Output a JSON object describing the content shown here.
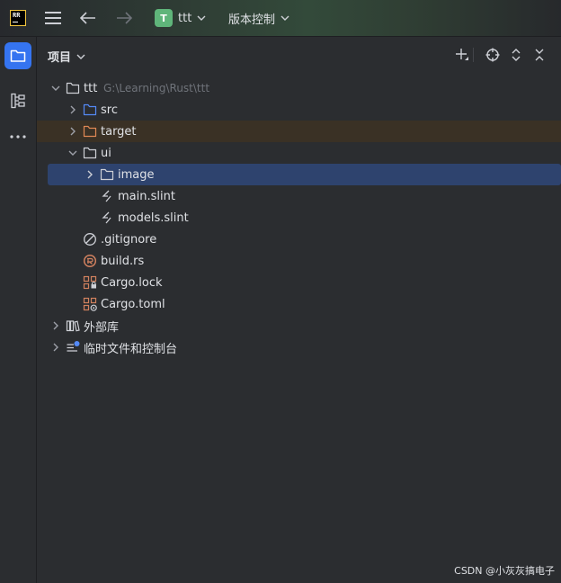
{
  "titlebar": {
    "logo_text": "RR",
    "project_badge": "T",
    "project_name": "ttt",
    "vcs_label": "版本控制"
  },
  "toolstrip": {
    "items": [
      {
        "name": "project",
        "icon": "folder-icon",
        "active": true
      },
      {
        "name": "structure",
        "icon": "structure-icon",
        "active": false
      },
      {
        "name": "more",
        "icon": "more-icon",
        "active": false
      }
    ]
  },
  "panel": {
    "title": "项目"
  },
  "tree": {
    "root": {
      "label": "ttt",
      "path": "G:\\Learning\\Rust\\ttt"
    },
    "items": [
      {
        "label": "src",
        "icon": "folder-icon"
      },
      {
        "label": "target",
        "icon": "folder-excluded-icon"
      },
      {
        "label": "ui",
        "icon": "folder-icon"
      },
      {
        "label": "image",
        "icon": "folder-icon"
      },
      {
        "label": "main.slint",
        "icon": "slint-file-icon"
      },
      {
        "label": "models.slint",
        "icon": "slint-file-icon"
      },
      {
        "label": ".gitignore",
        "icon": "ignore-file-icon"
      },
      {
        "label": "build.rs",
        "icon": "rust-file-icon"
      },
      {
        "label": "Cargo.lock",
        "icon": "cargo-lock-icon"
      },
      {
        "label": "Cargo.toml",
        "icon": "cargo-toml-icon"
      },
      {
        "label": "外部库",
        "icon": "library-icon"
      },
      {
        "label": "临时文件和控制台",
        "icon": "scratches-icon"
      }
    ]
  },
  "colors": {
    "accent": "#3574f0",
    "selection": "#2e436e",
    "excluded_bg": "#3a3125",
    "project_badge": "#5fb57a"
  },
  "watermark": "CSDN @小灰灰搞电子"
}
